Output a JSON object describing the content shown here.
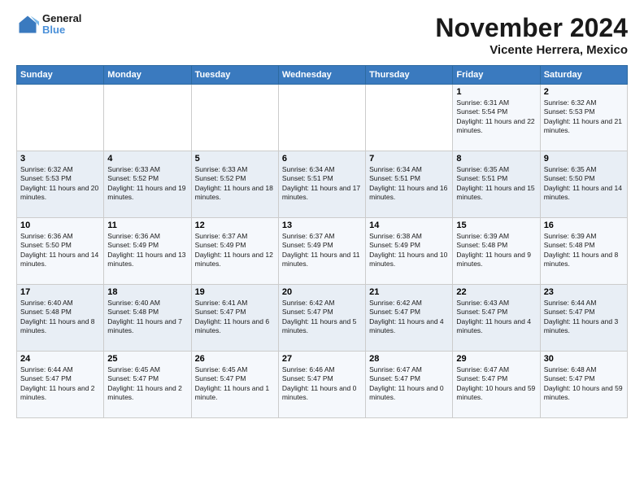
{
  "logo": {
    "line1": "General",
    "line2": "Blue"
  },
  "title": "November 2024",
  "subtitle": "Vicente Herrera, Mexico",
  "days_of_week": [
    "Sunday",
    "Monday",
    "Tuesday",
    "Wednesday",
    "Thursday",
    "Friday",
    "Saturday"
  ],
  "weeks": [
    [
      {
        "day": "",
        "info": ""
      },
      {
        "day": "",
        "info": ""
      },
      {
        "day": "",
        "info": ""
      },
      {
        "day": "",
        "info": ""
      },
      {
        "day": "",
        "info": ""
      },
      {
        "day": "1",
        "info": "Sunrise: 6:31 AM\nSunset: 5:54 PM\nDaylight: 11 hours and 22 minutes."
      },
      {
        "day": "2",
        "info": "Sunrise: 6:32 AM\nSunset: 5:53 PM\nDaylight: 11 hours and 21 minutes."
      }
    ],
    [
      {
        "day": "3",
        "info": "Sunrise: 6:32 AM\nSunset: 5:53 PM\nDaylight: 11 hours and 20 minutes."
      },
      {
        "day": "4",
        "info": "Sunrise: 6:33 AM\nSunset: 5:52 PM\nDaylight: 11 hours and 19 minutes."
      },
      {
        "day": "5",
        "info": "Sunrise: 6:33 AM\nSunset: 5:52 PM\nDaylight: 11 hours and 18 minutes."
      },
      {
        "day": "6",
        "info": "Sunrise: 6:34 AM\nSunset: 5:51 PM\nDaylight: 11 hours and 17 minutes."
      },
      {
        "day": "7",
        "info": "Sunrise: 6:34 AM\nSunset: 5:51 PM\nDaylight: 11 hours and 16 minutes."
      },
      {
        "day": "8",
        "info": "Sunrise: 6:35 AM\nSunset: 5:51 PM\nDaylight: 11 hours and 15 minutes."
      },
      {
        "day": "9",
        "info": "Sunrise: 6:35 AM\nSunset: 5:50 PM\nDaylight: 11 hours and 14 minutes."
      }
    ],
    [
      {
        "day": "10",
        "info": "Sunrise: 6:36 AM\nSunset: 5:50 PM\nDaylight: 11 hours and 14 minutes."
      },
      {
        "day": "11",
        "info": "Sunrise: 6:36 AM\nSunset: 5:49 PM\nDaylight: 11 hours and 13 minutes."
      },
      {
        "day": "12",
        "info": "Sunrise: 6:37 AM\nSunset: 5:49 PM\nDaylight: 11 hours and 12 minutes."
      },
      {
        "day": "13",
        "info": "Sunrise: 6:37 AM\nSunset: 5:49 PM\nDaylight: 11 hours and 11 minutes."
      },
      {
        "day": "14",
        "info": "Sunrise: 6:38 AM\nSunset: 5:49 PM\nDaylight: 11 hours and 10 minutes."
      },
      {
        "day": "15",
        "info": "Sunrise: 6:39 AM\nSunset: 5:48 PM\nDaylight: 11 hours and 9 minutes."
      },
      {
        "day": "16",
        "info": "Sunrise: 6:39 AM\nSunset: 5:48 PM\nDaylight: 11 hours and 8 minutes."
      }
    ],
    [
      {
        "day": "17",
        "info": "Sunrise: 6:40 AM\nSunset: 5:48 PM\nDaylight: 11 hours and 8 minutes."
      },
      {
        "day": "18",
        "info": "Sunrise: 6:40 AM\nSunset: 5:48 PM\nDaylight: 11 hours and 7 minutes."
      },
      {
        "day": "19",
        "info": "Sunrise: 6:41 AM\nSunset: 5:47 PM\nDaylight: 11 hours and 6 minutes."
      },
      {
        "day": "20",
        "info": "Sunrise: 6:42 AM\nSunset: 5:47 PM\nDaylight: 11 hours and 5 minutes."
      },
      {
        "day": "21",
        "info": "Sunrise: 6:42 AM\nSunset: 5:47 PM\nDaylight: 11 hours and 4 minutes."
      },
      {
        "day": "22",
        "info": "Sunrise: 6:43 AM\nSunset: 5:47 PM\nDaylight: 11 hours and 4 minutes."
      },
      {
        "day": "23",
        "info": "Sunrise: 6:44 AM\nSunset: 5:47 PM\nDaylight: 11 hours and 3 minutes."
      }
    ],
    [
      {
        "day": "24",
        "info": "Sunrise: 6:44 AM\nSunset: 5:47 PM\nDaylight: 11 hours and 2 minutes."
      },
      {
        "day": "25",
        "info": "Sunrise: 6:45 AM\nSunset: 5:47 PM\nDaylight: 11 hours and 2 minutes."
      },
      {
        "day": "26",
        "info": "Sunrise: 6:45 AM\nSunset: 5:47 PM\nDaylight: 11 hours and 1 minute."
      },
      {
        "day": "27",
        "info": "Sunrise: 6:46 AM\nSunset: 5:47 PM\nDaylight: 11 hours and 0 minutes."
      },
      {
        "day": "28",
        "info": "Sunrise: 6:47 AM\nSunset: 5:47 PM\nDaylight: 11 hours and 0 minutes."
      },
      {
        "day": "29",
        "info": "Sunrise: 6:47 AM\nSunset: 5:47 PM\nDaylight: 10 hours and 59 minutes."
      },
      {
        "day": "30",
        "info": "Sunrise: 6:48 AM\nSunset: 5:47 PM\nDaylight: 10 hours and 59 minutes."
      }
    ]
  ]
}
